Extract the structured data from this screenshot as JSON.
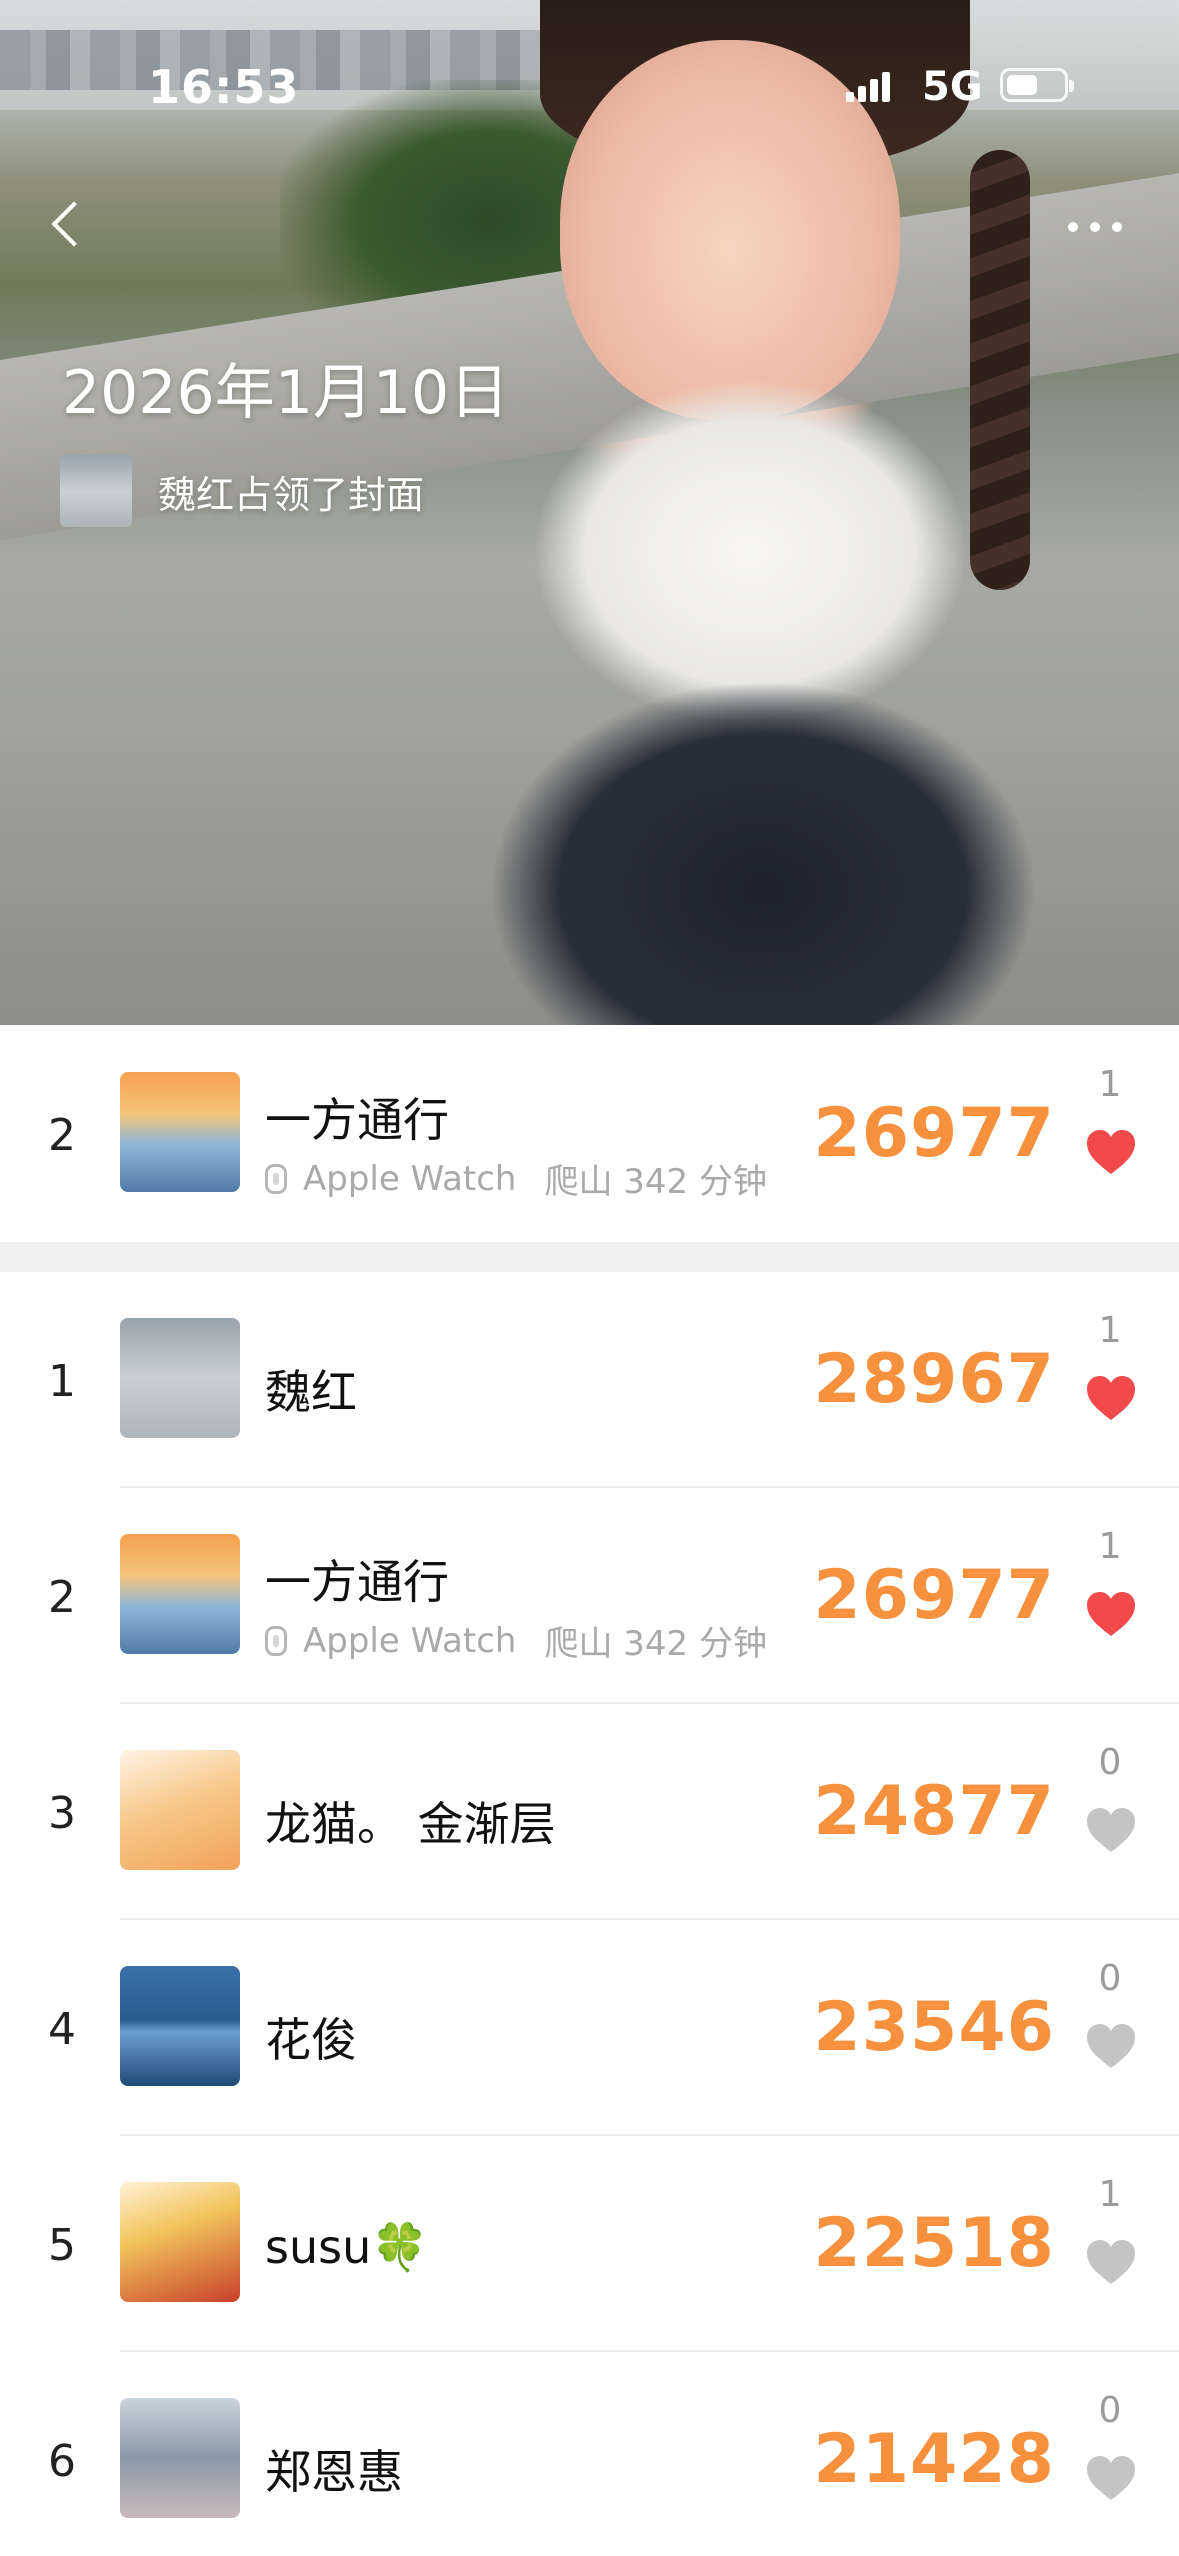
{
  "status_bar": {
    "time": "16:53",
    "network": "5G"
  },
  "cover": {
    "date": "2026年1月10日",
    "owner_text": "魏红占领了封面"
  },
  "my_entry": {
    "rank": "2",
    "name": "一方通行",
    "device": "Apple Watch",
    "activity": "爬山 342 分钟",
    "steps": "26977",
    "likes": "1",
    "liked": true
  },
  "leaderboard": [
    {
      "rank": "1",
      "name": "魏红",
      "device": "",
      "activity": "",
      "steps": "28967",
      "likes": "1",
      "liked": true
    },
    {
      "rank": "2",
      "name": "一方通行",
      "device": "Apple Watch",
      "activity": "爬山 342 分钟",
      "steps": "26977",
      "likes": "1",
      "liked": true
    },
    {
      "rank": "3",
      "name": "龙猫。 金渐层",
      "device": "",
      "activity": "",
      "steps": "24877",
      "likes": "0",
      "liked": false
    },
    {
      "rank": "4",
      "name": "花俊",
      "device": "",
      "activity": "",
      "steps": "23546",
      "likes": "0",
      "liked": false
    },
    {
      "rank": "5",
      "name": "susu🍀",
      "device": "",
      "activity": "",
      "steps": "22518",
      "likes": "1",
      "liked": false
    },
    {
      "rank": "6",
      "name": "郑恩惠",
      "device": "",
      "activity": "",
      "steps": "21428",
      "likes": "0",
      "liked": false
    }
  ],
  "colors": {
    "steps": "#f7913d",
    "heart_active": "#f24a4a",
    "heart_inactive": "#c4c4c4"
  }
}
